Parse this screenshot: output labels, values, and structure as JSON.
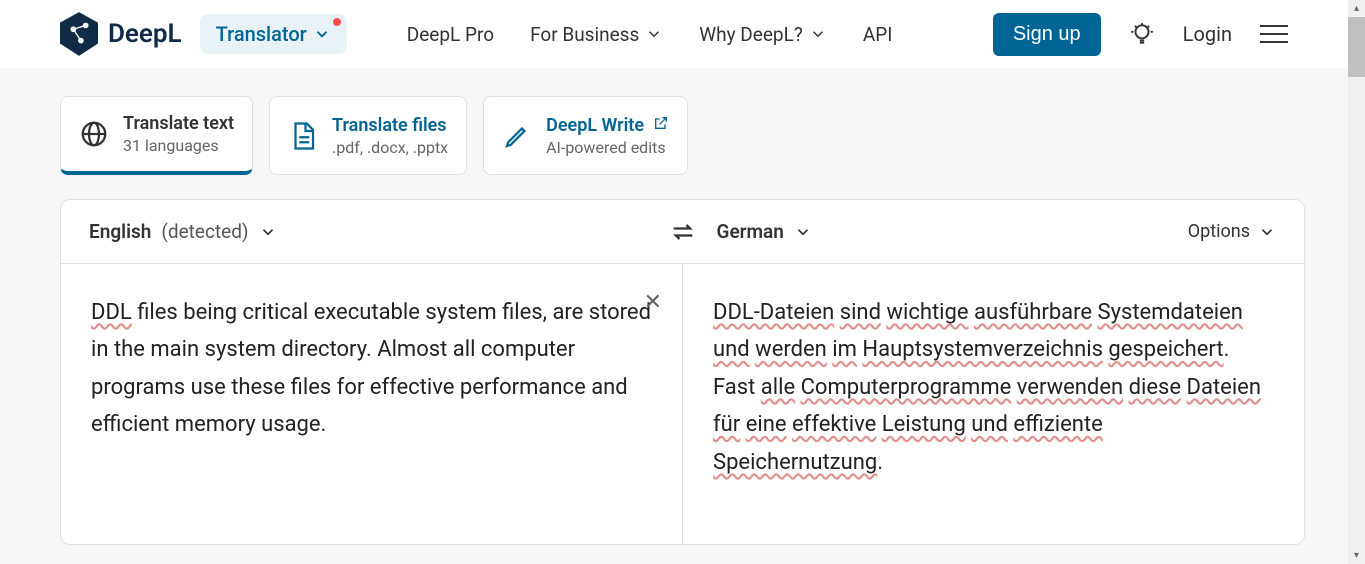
{
  "brand": "DeepL",
  "translatorPill": "Translator",
  "nav": {
    "pro": "DeepL Pro",
    "business": "For Business",
    "why": "Why DeepL?",
    "api": "API"
  },
  "signup": "Sign up",
  "login": "Login",
  "modes": {
    "text": {
      "title": "Translate text",
      "sub": "31 languages"
    },
    "files": {
      "title": "Translate files",
      "sub": ".pdf, .docx, .pptx"
    },
    "write": {
      "title": "DeepL Write",
      "sub": "AI-powered edits"
    }
  },
  "langs": {
    "sourceName": "English",
    "sourceDetected": "(detected)",
    "targetName": "German",
    "options": "Options"
  },
  "source": {
    "w1": "DDL",
    "rest": " files being critical executable system files, are stored in the main system directory. Almost all computer programs use these files for effective performance and efficient memory usage."
  },
  "target": {
    "w1": "DDL-Dateien",
    "w2": "sind",
    "w3": "wichtige",
    "w4": "ausführbare",
    "w5": "Systemdateien",
    "w6": "und",
    "w7": "werden",
    "w8": "im",
    "w9": "Hauptsystemverzeichnis",
    "w10": "gespeichert",
    "p1": ". Fast ",
    "w11": "alle",
    "w12": "Computerprogramme",
    "w13": "verwenden",
    "w14": "diese",
    "w15": "Dateien",
    "w16": "für",
    "w17": "eine",
    "w18": "effektive",
    "w19": "Leistung",
    "w20": "und",
    "w21": "effiziente",
    "w22": "Speichernutzung",
    "p2": "."
  }
}
